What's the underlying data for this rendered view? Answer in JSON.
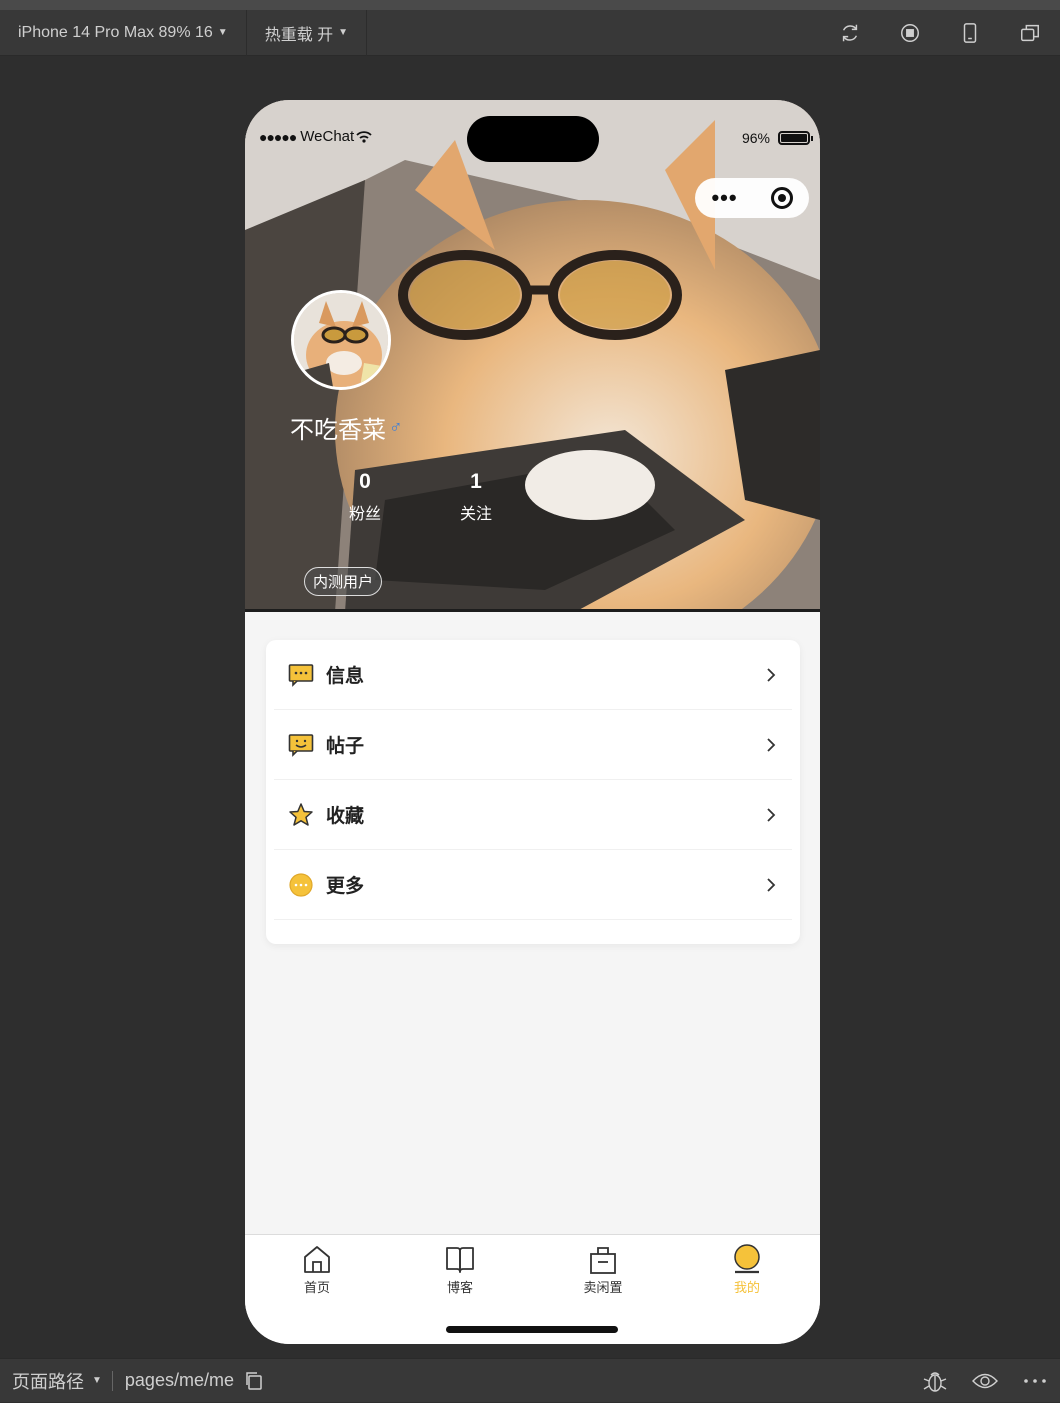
{
  "toolbar": {
    "device": "iPhone 14 Pro Max 89% 16",
    "hot_reload": "热重载 开",
    "icons": [
      "refresh-icon",
      "stop-icon",
      "phone-icon",
      "window-icon"
    ]
  },
  "status_bar": {
    "carrier": "WeChat",
    "battery": "96%"
  },
  "profile": {
    "username": "不吃香菜",
    "gender_symbol": "♂",
    "fans_count": "0",
    "fans_label": "粉丝",
    "follow_count": "1",
    "follow_label": "关注",
    "badge": "内测用户"
  },
  "menu": {
    "items": [
      {
        "label": "信息",
        "icon": "message-icon"
      },
      {
        "label": "帖子",
        "icon": "post-icon"
      },
      {
        "label": "收藏",
        "icon": "star-icon"
      },
      {
        "label": "更多",
        "icon": "more-icon"
      }
    ]
  },
  "tabbar": {
    "tabs": [
      {
        "label": "首页",
        "icon": "home-icon"
      },
      {
        "label": "博客",
        "icon": "book-icon"
      },
      {
        "label": "卖闲置",
        "icon": "bag-icon"
      },
      {
        "label": "我的",
        "icon": "user-icon"
      }
    ],
    "active_index": 3
  },
  "bottom_bar": {
    "path_label": "页面路径",
    "path_value": "pages/me/me"
  },
  "colors": {
    "accent": "#f5c23a",
    "gender": "#3f7fd6"
  }
}
